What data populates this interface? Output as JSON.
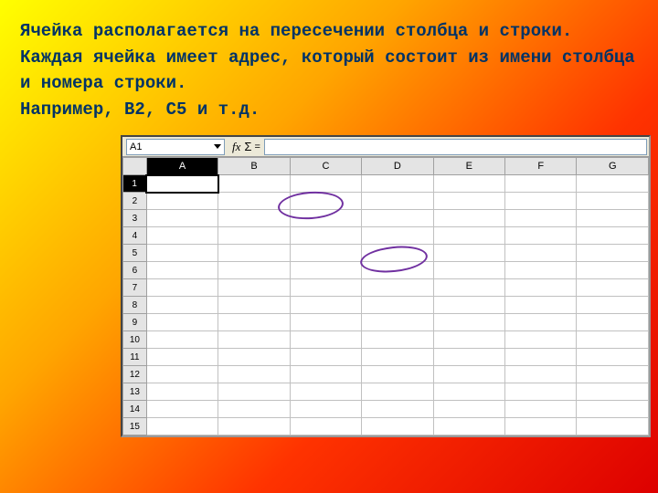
{
  "text": {
    "p1": "Ячейка располагается на пересечении столбца и строки.",
    "p2": "Каждая ячейка имеет адрес, который состоит из имени столбца и номера строки.",
    "p3": "Например, В2, С5 и т.д."
  },
  "sheet": {
    "name_box": "A1",
    "fx_label": "fx",
    "sigma_label": "Σ",
    "eq_label": "=",
    "formula_value": "",
    "columns": [
      "A",
      "B",
      "C",
      "D",
      "E",
      "F",
      "G"
    ],
    "rows": [
      "1",
      "2",
      "3",
      "4",
      "5",
      "6",
      "7",
      "8",
      "9",
      "10",
      "11",
      "12",
      "13",
      "14",
      "15"
    ],
    "selected_col": "A",
    "selected_row": "1",
    "active_cell": "A1"
  }
}
